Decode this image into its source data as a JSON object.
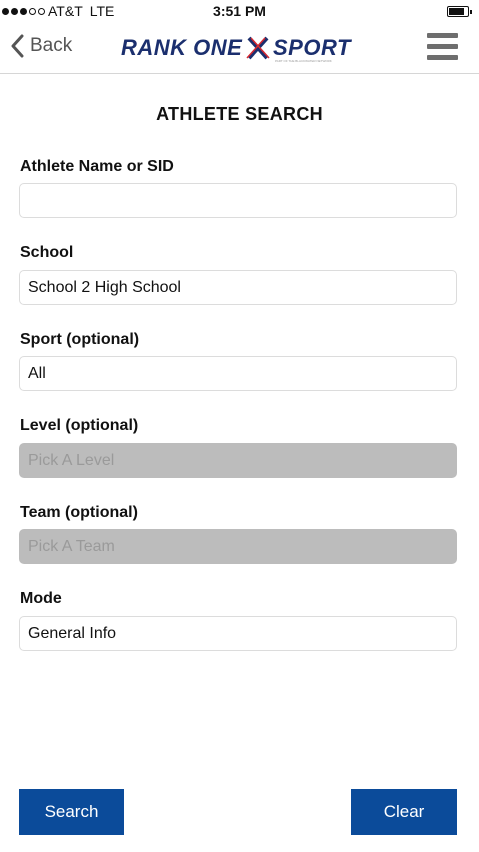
{
  "status_bar": {
    "carrier": "AT&T",
    "network": "LTE",
    "time": "3:51 PM"
  },
  "nav": {
    "back_label": "Back",
    "logo_left": "RANK ONE",
    "logo_right": "SPORT",
    "logo_tagline": "PART OF THE BLACKWATER NETWORK",
    "logo_color": "#1b2f6e",
    "logo_accent_color": "#d7282f"
  },
  "page": {
    "title": "ATHLETE SEARCH"
  },
  "fields": {
    "athlete": {
      "label": "Athlete Name or SID",
      "value": "",
      "placeholder": ""
    },
    "school": {
      "label": "School",
      "value": "School 2 High School"
    },
    "sport": {
      "label": "Sport (optional)",
      "value": "All"
    },
    "level": {
      "label": "Level (optional)",
      "placeholder": "Pick A Level"
    },
    "team": {
      "label": "Team (optional)",
      "placeholder": "Pick A Team"
    },
    "mode": {
      "label": "Mode",
      "value": "General Info"
    }
  },
  "actions": {
    "search_label": "Search",
    "clear_label": "Clear",
    "button_color": "#0b4b9a"
  }
}
